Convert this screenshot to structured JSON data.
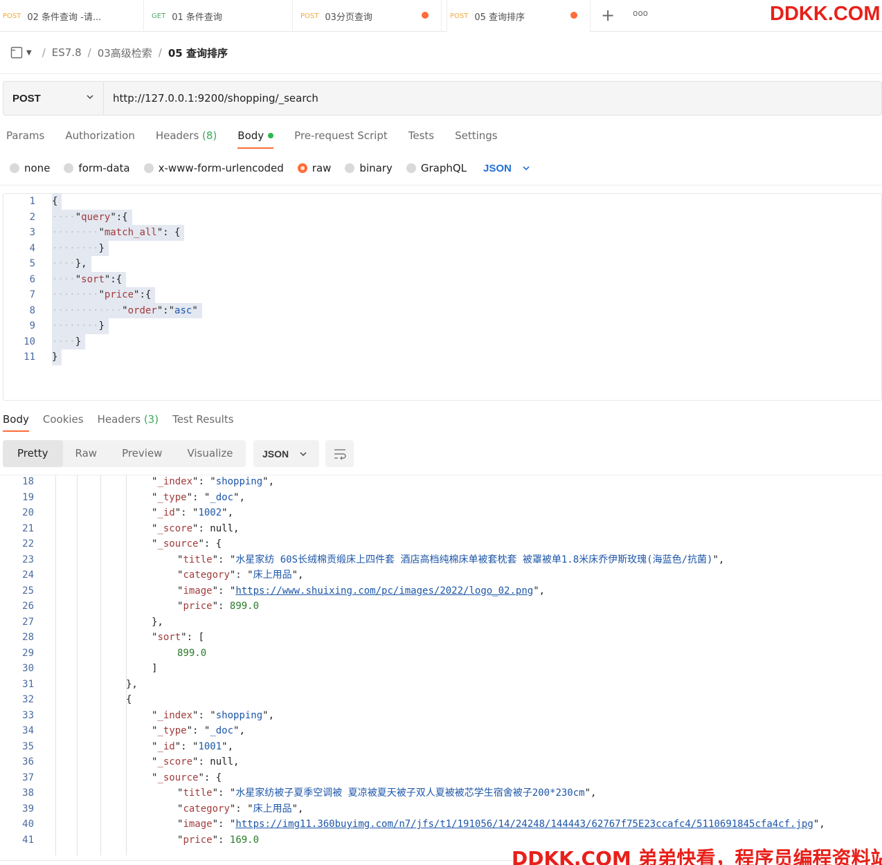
{
  "tabs": [
    {
      "method": "POST",
      "name": "02 条件查询 -请...",
      "unsaved": false
    },
    {
      "method": "GET",
      "name": "01 条件查询",
      "unsaved": false
    },
    {
      "method": "POST",
      "name": "03分页查询",
      "unsaved": true
    },
    {
      "method": "POST",
      "name": "05 查询排序",
      "unsaved": true
    }
  ],
  "tab_actions": {
    "new": "+",
    "more": "ooo"
  },
  "brand": "DDKK.COM",
  "breadcrumb": {
    "collection": "ES7.8",
    "folder": "03高级检索",
    "current": "05 查询排序",
    "sep": "/"
  },
  "request": {
    "method": "POST",
    "url": "http://127.0.0.1:9200/shopping/_search"
  },
  "request_tabs": {
    "params": "Params",
    "authorization": "Authorization",
    "headers": "Headers",
    "headers_count": "(8)",
    "body": "Body",
    "prerequest": "Pre-request Script",
    "tests": "Tests",
    "settings": "Settings"
  },
  "body_types": {
    "none": "none",
    "form_data": "form-data",
    "urlencoded": "x-www-form-urlencoded",
    "raw": "raw",
    "binary": "binary",
    "graphql": "GraphQL",
    "selected": "raw",
    "language": "JSON"
  },
  "request_body": [
    {
      "n": "1",
      "indent": 0,
      "code": "{"
    },
    {
      "n": "2",
      "indent": 1,
      "code": "\"query\":{"
    },
    {
      "n": "3",
      "indent": 2,
      "code": "\"match_all\": {"
    },
    {
      "n": "4",
      "indent": 2,
      "code": "}"
    },
    {
      "n": "5",
      "indent": 1,
      "code": "},"
    },
    {
      "n": "6",
      "indent": 1,
      "code": "\"sort\":{"
    },
    {
      "n": "7",
      "indent": 2,
      "code": "\"price\":{"
    },
    {
      "n": "8",
      "indent": 3,
      "code": "\"order\":\"asc\""
    },
    {
      "n": "9",
      "indent": 2,
      "code": "}"
    },
    {
      "n": "10",
      "indent": 1,
      "code": "}"
    },
    {
      "n": "11",
      "indent": 0,
      "code": "}"
    }
  ],
  "response_tabs": {
    "body": "Body",
    "cookies": "Cookies",
    "headers": "Headers",
    "headers_count": "(3)",
    "test_results": "Test Results"
  },
  "view_modes": {
    "pretty": "Pretty",
    "raw": "Raw",
    "preview": "Preview",
    "visualize": "Visualize",
    "format": "JSON"
  },
  "response_body": [
    {
      "n": "18",
      "indent": 4,
      "code": "\"_index\": \"shopping\","
    },
    {
      "n": "19",
      "indent": 4,
      "code": "\"_type\": \"_doc\","
    },
    {
      "n": "20",
      "indent": 4,
      "code": "\"_id\": \"1002\","
    },
    {
      "n": "21",
      "indent": 4,
      "code": "\"_score\": null,"
    },
    {
      "n": "22",
      "indent": 4,
      "code": "\"_source\": {"
    },
    {
      "n": "23",
      "indent": 5,
      "code": "\"title\": \"水星家纺 60S长绒棉贡缎床上四件套 酒店高档纯棉床单被套枕套 被罩被单1.8米床乔伊斯玫瑰(海蓝色/抗菌)\","
    },
    {
      "n": "24",
      "indent": 5,
      "code": "\"category\": \"床上用品\","
    },
    {
      "n": "25",
      "indent": 5,
      "code": "\"image\": \"https://www.shuixing.com/pc/images/2022/logo_02.png\","
    },
    {
      "n": "26",
      "indent": 5,
      "code": "\"price\": 899.0"
    },
    {
      "n": "27",
      "indent": 4,
      "code": "},"
    },
    {
      "n": "28",
      "indent": 4,
      "code": "\"sort\": ["
    },
    {
      "n": "29",
      "indent": 5,
      "code": "899.0"
    },
    {
      "n": "30",
      "indent": 4,
      "code": "]"
    },
    {
      "n": "31",
      "indent": 3,
      "code": "},"
    },
    {
      "n": "32",
      "indent": 3,
      "code": "{"
    },
    {
      "n": "33",
      "indent": 4,
      "code": "\"_index\": \"shopping\","
    },
    {
      "n": "34",
      "indent": 4,
      "code": "\"_type\": \"_doc\","
    },
    {
      "n": "35",
      "indent": 4,
      "code": "\"_id\": \"1001\","
    },
    {
      "n": "36",
      "indent": 4,
      "code": "\"_score\": null,"
    },
    {
      "n": "37",
      "indent": 4,
      "code": "\"_source\": {"
    },
    {
      "n": "38",
      "indent": 5,
      "code": "\"title\": \"水星家纺被子夏季空调被 夏凉被夏天被子双人夏被被芯学生宿舍被子200*230cm\","
    },
    {
      "n": "39",
      "indent": 5,
      "code": "\"category\": \"床上用品\","
    },
    {
      "n": "40",
      "indent": 5,
      "code": "\"image\": \"https://img11.360buyimg.com/n7/jfs/t1/191056/14/24248/144443/62767f75E23ccafc4/5110691845cfa4cf.jpg\","
    },
    {
      "n": "41",
      "indent": 5,
      "code": "\"price\": 169.0"
    }
  ],
  "watermark": "DDKK.COM 弟弟快看，程序员编程资料站",
  "colors": {
    "accent": "#ff6c37",
    "brand_red": "#e8201a",
    "link_blue": "#1c56a8",
    "number_green": "#2a7a2a",
    "count_green": "#3aa85a"
  }
}
